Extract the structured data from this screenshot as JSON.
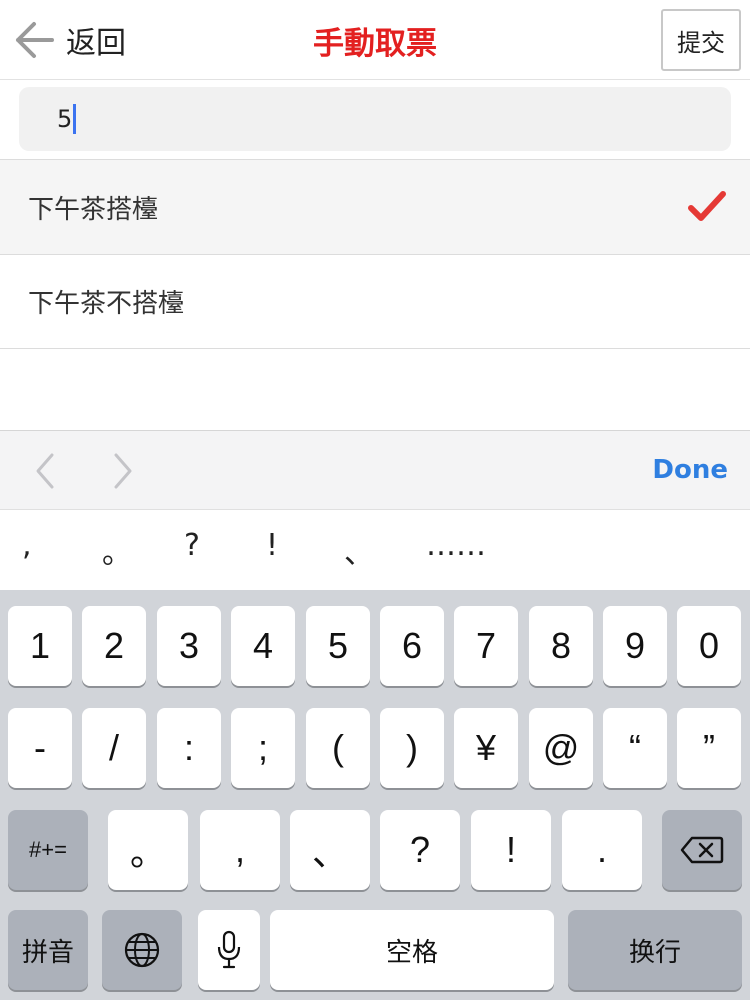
{
  "header": {
    "back_label": "返回",
    "title": "手動取票",
    "submit_label": "提交"
  },
  "search": {
    "value": "5"
  },
  "list": [
    {
      "label": "下午茶搭檯",
      "selected": true
    },
    {
      "label": "下午茶不搭檯",
      "selected": false
    }
  ],
  "accessory": {
    "done_label": "Done"
  },
  "candidates": [
    ",",
    "。",
    "?",
    "!",
    "、",
    "……"
  ],
  "keyboard": {
    "row1": [
      "1",
      "2",
      "3",
      "4",
      "5",
      "6",
      "7",
      "8",
      "9",
      "0"
    ],
    "row2": [
      "-",
      "/",
      ":",
      ";",
      "(",
      ")",
      "¥",
      "@",
      "“",
      "”"
    ],
    "row3_mode": "#+=",
    "row3": [
      "。",
      ",",
      "、",
      "?",
      "!",
      "."
    ],
    "row4": {
      "pinyin": "拼音",
      "space": "空格",
      "return": "换行"
    }
  },
  "colors": {
    "title": "#e32020",
    "checkmark": "#e53935",
    "done": "#2f7fe0",
    "caret": "#3b73f0"
  }
}
